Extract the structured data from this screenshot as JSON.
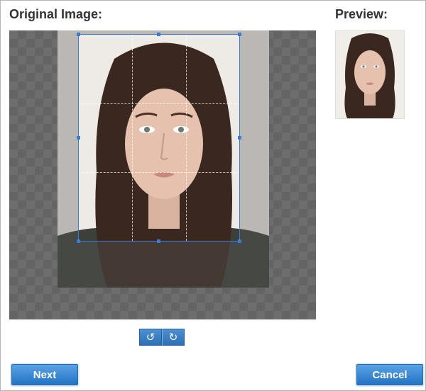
{
  "headings": {
    "original": "Original Image:",
    "preview": "Preview:"
  },
  "icons": {
    "rotate_left": "rotate-left-icon",
    "rotate_right": "rotate-right-icon"
  },
  "buttons": {
    "next": "Next",
    "cancel": "Cancel"
  },
  "colors": {
    "accent": "#2c7ad0",
    "crop_border": "#3a7bd5"
  }
}
